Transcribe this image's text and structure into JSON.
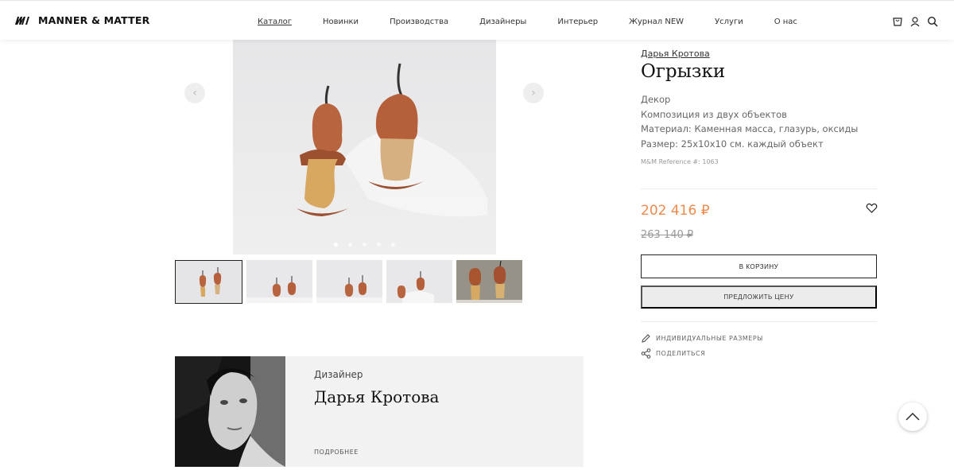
{
  "header": {
    "logo_mark": "m",
    "logo_text": "MANNER & MATTER",
    "nav": [
      "Каталог",
      "Новинки",
      "Производства",
      "Дизайнеры",
      "Интерьер",
      "Журнал NEW",
      "Услуги",
      "О нас"
    ],
    "icons": [
      "cart-icon",
      "user-icon",
      "search-icon"
    ]
  },
  "gallery": {
    "prev": "‹",
    "next": "›",
    "slides": 5,
    "active_slide": 1,
    "thumbnails": 5
  },
  "product": {
    "designer": "Дарья Кротова",
    "title": "Огрызки",
    "details": [
      "Декор",
      "Композиция из двух объектов",
      "Материал: Каменная масса, глазурь, оксиды",
      "Размер: 25х10х10 см. каждый объект"
    ],
    "reference": "M&M Reference #: 1063",
    "price": "202 416 ₽",
    "old_price": "263 140 ₽",
    "add_to_cart": "В КОРЗИНУ",
    "make_offer": "ПРЕДЛОЖИТЬ ЦЕНУ",
    "custom_sizes": "ИНДИВИДУАЛЬНЫЕ РАЗМЕРЫ",
    "share": "ПОДЕЛИТЬСЯ"
  },
  "designer_card": {
    "kicker": "Дизайнер",
    "name": "Дарья Кротова",
    "more": "ПОДРОБНЕЕ"
  },
  "colors": {
    "accent_price": "#f08a4b",
    "text": "#222222",
    "muted": "#666666"
  }
}
